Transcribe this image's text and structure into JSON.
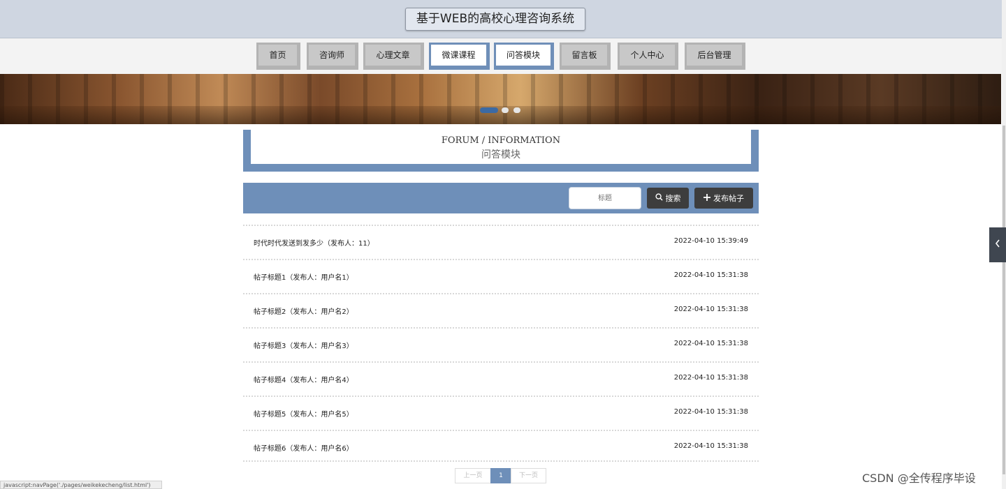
{
  "header": {
    "title": "基于WEB的高校心理咨询系统"
  },
  "nav": {
    "items": [
      {
        "label": "首页"
      },
      {
        "label": "咨询师"
      },
      {
        "label": "心理文章"
      },
      {
        "label": "微课课程"
      },
      {
        "label": "问答模块"
      },
      {
        "label": "留言板"
      },
      {
        "label": "个人中心"
      },
      {
        "label": "后台管理"
      }
    ],
    "active": "问答模块"
  },
  "carousel": {
    "slide_count": 3,
    "active_index": 0
  },
  "section": {
    "title_en": "FORUM / INFORMATION",
    "title_cn": "问答模块"
  },
  "search": {
    "placeholder": "标题",
    "search_label": "搜索",
    "post_label": "发布帖子"
  },
  "posts": [
    {
      "title": "时代时代发送到发多少（发布人：11）",
      "time": "2022-04-10 15:39:49"
    },
    {
      "title": "帖子标题1（发布人：用户名1）",
      "time": "2022-04-10 15:31:38"
    },
    {
      "title": "帖子标题2（发布人：用户名2）",
      "time": "2022-04-10 15:31:38"
    },
    {
      "title": "帖子标题3（发布人：用户名3）",
      "time": "2022-04-10 15:31:38"
    },
    {
      "title": "帖子标题4（发布人：用户名4）",
      "time": "2022-04-10 15:31:38"
    },
    {
      "title": "帖子标题5（发布人：用户名5）",
      "time": "2022-04-10 15:31:38"
    },
    {
      "title": "帖子标题6（发布人：用户名6）",
      "time": "2022-04-10 15:31:38"
    }
  ],
  "pagination": {
    "prev": "上一页",
    "current": "1",
    "next": "下一页"
  },
  "status_url": "javascript:navPage('./pages/weikekecheng/list.html')",
  "watermark": "CSDN @全传程序毕设",
  "colors": {
    "accent": "#6e8fb9",
    "header_bg": "#cfd6e1",
    "button_dark": "#3d3d3d"
  }
}
